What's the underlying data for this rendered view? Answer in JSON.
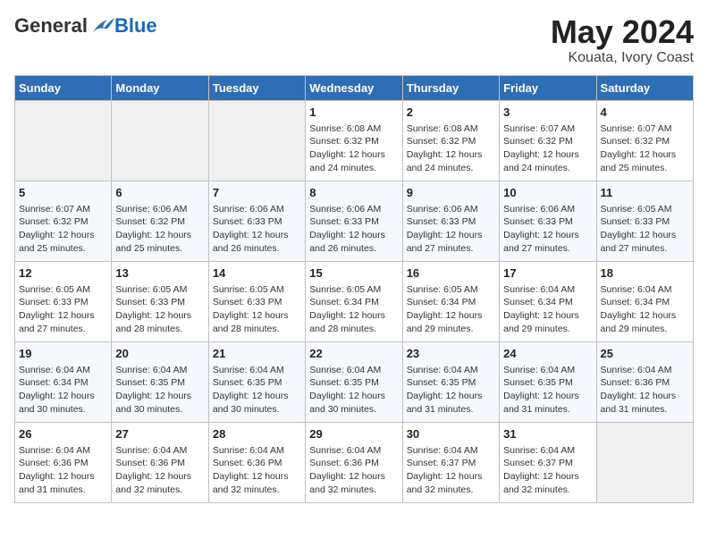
{
  "header": {
    "logo_general": "General",
    "logo_blue": "Blue",
    "month": "May 2024",
    "location": "Kouata, Ivory Coast"
  },
  "days_of_week": [
    "Sunday",
    "Monday",
    "Tuesday",
    "Wednesday",
    "Thursday",
    "Friday",
    "Saturday"
  ],
  "weeks": [
    [
      {
        "day": "",
        "info": ""
      },
      {
        "day": "",
        "info": ""
      },
      {
        "day": "",
        "info": ""
      },
      {
        "day": "1",
        "info": "Sunrise: 6:08 AM\nSunset: 6:32 PM\nDaylight: 12 hours\nand 24 minutes."
      },
      {
        "day": "2",
        "info": "Sunrise: 6:08 AM\nSunset: 6:32 PM\nDaylight: 12 hours\nand 24 minutes."
      },
      {
        "day": "3",
        "info": "Sunrise: 6:07 AM\nSunset: 6:32 PM\nDaylight: 12 hours\nand 24 minutes."
      },
      {
        "day": "4",
        "info": "Sunrise: 6:07 AM\nSunset: 6:32 PM\nDaylight: 12 hours\nand 25 minutes."
      }
    ],
    [
      {
        "day": "5",
        "info": "Sunrise: 6:07 AM\nSunset: 6:32 PM\nDaylight: 12 hours\nand 25 minutes."
      },
      {
        "day": "6",
        "info": "Sunrise: 6:06 AM\nSunset: 6:32 PM\nDaylight: 12 hours\nand 25 minutes."
      },
      {
        "day": "7",
        "info": "Sunrise: 6:06 AM\nSunset: 6:33 PM\nDaylight: 12 hours\nand 26 minutes."
      },
      {
        "day": "8",
        "info": "Sunrise: 6:06 AM\nSunset: 6:33 PM\nDaylight: 12 hours\nand 26 minutes."
      },
      {
        "day": "9",
        "info": "Sunrise: 6:06 AM\nSunset: 6:33 PM\nDaylight: 12 hours\nand 27 minutes."
      },
      {
        "day": "10",
        "info": "Sunrise: 6:06 AM\nSunset: 6:33 PM\nDaylight: 12 hours\nand 27 minutes."
      },
      {
        "day": "11",
        "info": "Sunrise: 6:05 AM\nSunset: 6:33 PM\nDaylight: 12 hours\nand 27 minutes."
      }
    ],
    [
      {
        "day": "12",
        "info": "Sunrise: 6:05 AM\nSunset: 6:33 PM\nDaylight: 12 hours\nand 27 minutes."
      },
      {
        "day": "13",
        "info": "Sunrise: 6:05 AM\nSunset: 6:33 PM\nDaylight: 12 hours\nand 28 minutes."
      },
      {
        "day": "14",
        "info": "Sunrise: 6:05 AM\nSunset: 6:33 PM\nDaylight: 12 hours\nand 28 minutes."
      },
      {
        "day": "15",
        "info": "Sunrise: 6:05 AM\nSunset: 6:34 PM\nDaylight: 12 hours\nand 28 minutes."
      },
      {
        "day": "16",
        "info": "Sunrise: 6:05 AM\nSunset: 6:34 PM\nDaylight: 12 hours\nand 29 minutes."
      },
      {
        "day": "17",
        "info": "Sunrise: 6:04 AM\nSunset: 6:34 PM\nDaylight: 12 hours\nand 29 minutes."
      },
      {
        "day": "18",
        "info": "Sunrise: 6:04 AM\nSunset: 6:34 PM\nDaylight: 12 hours\nand 29 minutes."
      }
    ],
    [
      {
        "day": "19",
        "info": "Sunrise: 6:04 AM\nSunset: 6:34 PM\nDaylight: 12 hours\nand 30 minutes."
      },
      {
        "day": "20",
        "info": "Sunrise: 6:04 AM\nSunset: 6:35 PM\nDaylight: 12 hours\nand 30 minutes."
      },
      {
        "day": "21",
        "info": "Sunrise: 6:04 AM\nSunset: 6:35 PM\nDaylight: 12 hours\nand 30 minutes."
      },
      {
        "day": "22",
        "info": "Sunrise: 6:04 AM\nSunset: 6:35 PM\nDaylight: 12 hours\nand 30 minutes."
      },
      {
        "day": "23",
        "info": "Sunrise: 6:04 AM\nSunset: 6:35 PM\nDaylight: 12 hours\nand 31 minutes."
      },
      {
        "day": "24",
        "info": "Sunrise: 6:04 AM\nSunset: 6:35 PM\nDaylight: 12 hours\nand 31 minutes."
      },
      {
        "day": "25",
        "info": "Sunrise: 6:04 AM\nSunset: 6:36 PM\nDaylight: 12 hours\nand 31 minutes."
      }
    ],
    [
      {
        "day": "26",
        "info": "Sunrise: 6:04 AM\nSunset: 6:36 PM\nDaylight: 12 hours\nand 31 minutes."
      },
      {
        "day": "27",
        "info": "Sunrise: 6:04 AM\nSunset: 6:36 PM\nDaylight: 12 hours\nand 32 minutes."
      },
      {
        "day": "28",
        "info": "Sunrise: 6:04 AM\nSunset: 6:36 PM\nDaylight: 12 hours\nand 32 minutes."
      },
      {
        "day": "29",
        "info": "Sunrise: 6:04 AM\nSunset: 6:36 PM\nDaylight: 12 hours\nand 32 minutes."
      },
      {
        "day": "30",
        "info": "Sunrise: 6:04 AM\nSunset: 6:37 PM\nDaylight: 12 hours\nand 32 minutes."
      },
      {
        "day": "31",
        "info": "Sunrise: 6:04 AM\nSunset: 6:37 PM\nDaylight: 12 hours\nand 32 minutes."
      },
      {
        "day": "",
        "info": ""
      }
    ]
  ]
}
